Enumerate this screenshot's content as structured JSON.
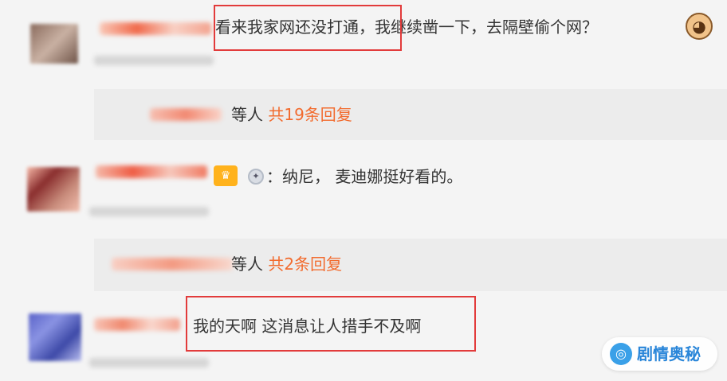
{
  "comments": [
    {
      "text": "看来我家网还没打通，我继续凿一下，去隔壁偷个网？",
      "emoji_icon": "cat-face-icon",
      "replies": {
        "prefix": "等人",
        "link": "共19条回复"
      }
    },
    {
      "text": "：纳尼， 麦迪娜挺好看的。",
      "badge_icon": "crown-badge-icon",
      "medal_icon": "medal-icon",
      "replies": {
        "prefix": "等人",
        "link": "共2条回复"
      }
    },
    {
      "text": "我的天啊 这消息让人措手不及啊"
    }
  ],
  "watermark": {
    "text": "剧情奥秘",
    "icon": "watermark-logo-icon"
  },
  "colors": {
    "highlight": "#e23b3b",
    "reply_link": "#f26b2e",
    "background": "#f4f4f4"
  }
}
